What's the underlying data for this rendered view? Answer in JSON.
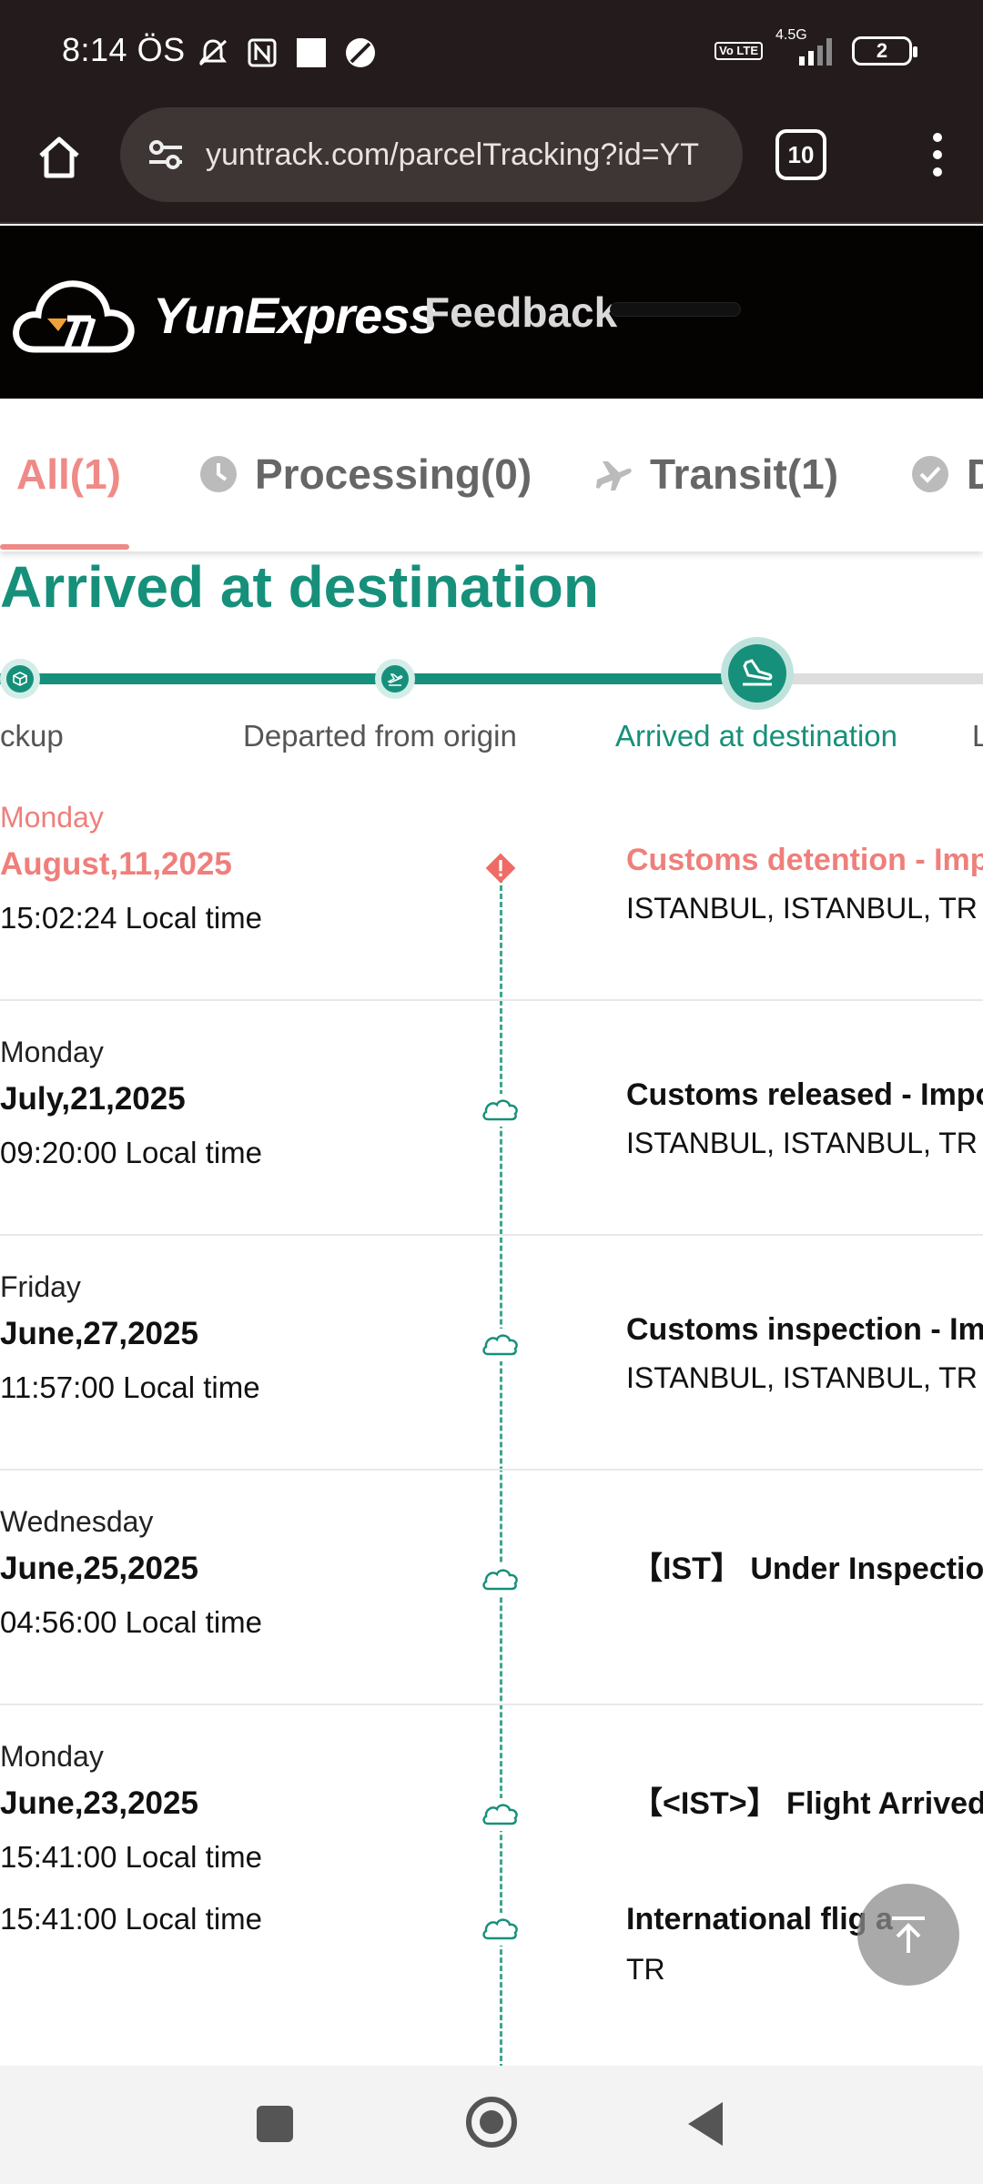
{
  "status_bar": {
    "time": "8:14 ÖS",
    "network": "4.5G",
    "volte": "Vo LTE",
    "battery": "2"
  },
  "browser": {
    "url": "yuntrack.com/parcelTracking?id=YT",
    "tab_count": "10"
  },
  "header": {
    "logo_text": "YunExpress",
    "feedback": "Feedback"
  },
  "tabs": [
    {
      "label": "All(1)"
    },
    {
      "label": "Processing(0)"
    },
    {
      "label": "Transit(1)"
    },
    {
      "label": "D"
    }
  ],
  "status_heading": "Arrived at destination",
  "progress_steps": [
    {
      "label": "ckup"
    },
    {
      "label": "Departed from origin"
    },
    {
      "label": "Arrived at destination"
    },
    {
      "label": "L"
    }
  ],
  "events": [
    {
      "day": "Monday",
      "date": "August,11,2025",
      "time": "15:02:24 Local time",
      "title": "Customs detention - Imp",
      "location": "ISTANBUL, ISTANBUL, TR"
    },
    {
      "day": "Monday",
      "date": "July,21,2025",
      "time": "09:20:00 Local time",
      "title": "Customs released - Impo",
      "location": "ISTANBUL, ISTANBUL, TR"
    },
    {
      "day": "Friday",
      "date": "June,27,2025",
      "time": "11:57:00 Local time",
      "title": "Customs inspection - Im",
      "location": "ISTANBUL, ISTANBUL, TR"
    },
    {
      "day": "Wednesday",
      "date": "June,25,2025",
      "time": "04:56:00 Local time",
      "title": "【IST】 Under Inspection",
      "location": ""
    },
    {
      "day": "Monday",
      "date": "June,23,2025",
      "time": "15:41:00 Local time",
      "title": "【<IST>】 Flight Arrived",
      "location": ""
    },
    {
      "day": "",
      "date": "",
      "time": "15:41:00 Local time",
      "title": "International flig    a",
      "location": "TR"
    }
  ],
  "colors": {
    "brand_green": "#16907a",
    "alert_red": "#ef7f7b",
    "header_bg": "#050202",
    "browser_bg": "#241c1c"
  }
}
